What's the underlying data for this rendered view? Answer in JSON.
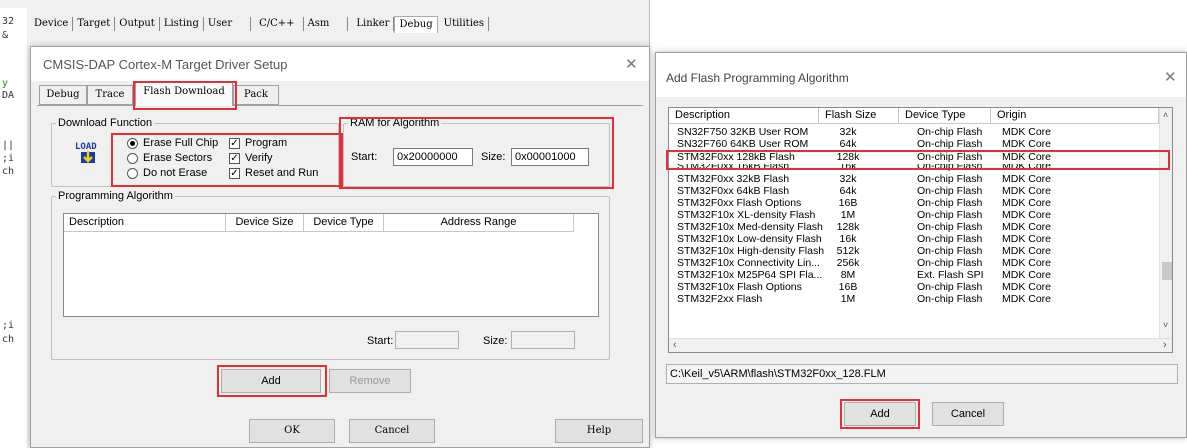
{
  "editor": {
    "code_fragments": [
      "32",
      "&",
      "y",
      "DA",
      "||",
      ";i",
      "ch",
      ";i",
      "ch"
    ]
  },
  "options_tabs": [
    "Device",
    "Target",
    "Output",
    "Listing",
    "User",
    "C/C++",
    "Asm",
    "Linker",
    "Debug",
    "Utilities"
  ],
  "driver_dialog": {
    "title": "CMSIS-DAP Cortex-M Target Driver Setup",
    "tabs": [
      "Debug",
      "Trace",
      "Flash Download",
      "Pack"
    ],
    "download_function": {
      "legend": "Download Function",
      "icon_text": "LOAD",
      "radios": [
        {
          "label": "Erase Full Chip",
          "checked": true
        },
        {
          "label": "Erase Sectors",
          "checked": false
        },
        {
          "label": "Do not Erase",
          "checked": false
        }
      ],
      "checks": [
        {
          "label": "Program",
          "checked": true
        },
        {
          "label": "Verify",
          "checked": true
        },
        {
          "label": "Reset and Run",
          "checked": true
        }
      ]
    },
    "ram": {
      "legend": "RAM for Algorithm",
      "start_label": "Start:",
      "start_value": "0x20000000",
      "size_label": "Size:",
      "size_value": "0x00001000"
    },
    "programming_algorithm": {
      "legend": "Programming Algorithm",
      "columns": [
        "Description",
        "Device Size",
        "Device Type",
        "Address Range"
      ],
      "start_label": "Start:",
      "size_label": "Size:"
    },
    "buttons": {
      "add": "Add",
      "remove": "Remove",
      "ok": "OK",
      "cancel": "Cancel",
      "help": "Help"
    }
  },
  "flash_dialog": {
    "title": "Add Flash Programming Algorithm",
    "columns": [
      "Description",
      "Flash Size",
      "Device Type",
      "Origin"
    ],
    "rows": [
      [
        "SN32F750 32KB User ROM",
        "32k",
        "On-chip Flash",
        "MDK Core"
      ],
      [
        "SN32F760 64KB User ROM",
        "64k",
        "On-chip Flash",
        "MDK Core"
      ],
      [
        "STM32F0xx 128kB Flash",
        "128k",
        "On-chip Flash",
        "MDK Core"
      ],
      [
        "STM32F0xx 16kB Flash",
        "16k",
        "On-chip Flash",
        "MDK Core"
      ],
      [
        "STM32F0xx 32kB Flash",
        "32k",
        "On-chip Flash",
        "MDK Core"
      ],
      [
        "STM32F0xx 64kB Flash",
        "64k",
        "On-chip Flash",
        "MDK Core"
      ],
      [
        "STM32F0xx Flash Options",
        "16B",
        "On-chip Flash",
        "MDK Core"
      ],
      [
        "STM32F10x XL-density Flash",
        "1M",
        "On-chip Flash",
        "MDK Core"
      ],
      [
        "STM32F10x Med-density Flash",
        "128k",
        "On-chip Flash",
        "MDK Core"
      ],
      [
        "STM32F10x Low-density Flash",
        "16k",
        "On-chip Flash",
        "MDK Core"
      ],
      [
        "STM32F10x High-density Flash",
        "512k",
        "On-chip Flash",
        "MDK Core"
      ],
      [
        "STM32F10x Connectivity Lin...",
        "256k",
        "On-chip Flash",
        "MDK Core"
      ],
      [
        "STM32F10x M25P64 SPI Fla...",
        "8M",
        "Ext. Flash SPI",
        "MDK Core"
      ],
      [
        "STM32F10x Flash Options",
        "16B",
        "On-chip Flash",
        "MDK Core"
      ],
      [
        "STM32F2xx Flash",
        "1M",
        "On-chip Flash",
        "MDK Core"
      ]
    ],
    "path": "C:\\Keil_v5\\ARM\\flash\\STM32F0xx_128.FLM",
    "buttons": {
      "add": "Add",
      "cancel": "Cancel"
    }
  },
  "colors": {
    "highlight": "#e0313b",
    "selection_row": "STM32F0xx 128kB Flash"
  }
}
